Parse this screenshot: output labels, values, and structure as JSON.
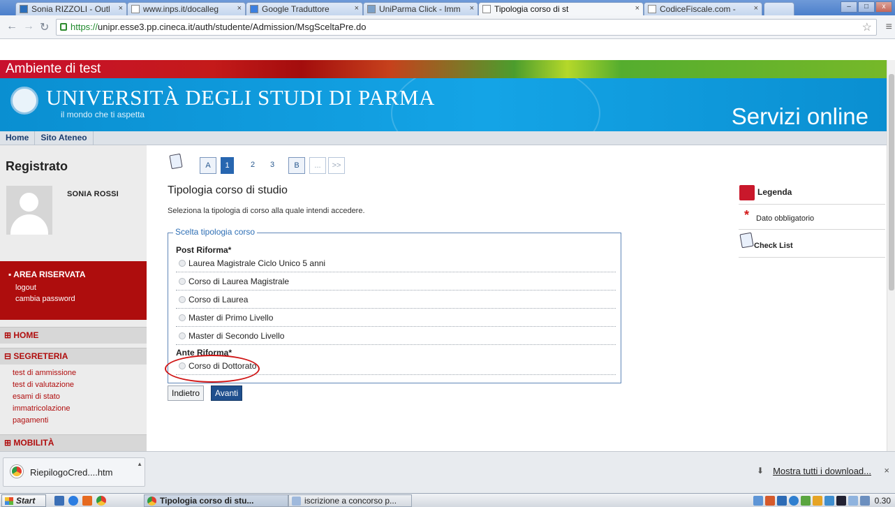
{
  "browser": {
    "tabs": [
      {
        "label": "Sonia RIZZOLI - Outl"
      },
      {
        "label": "www.inps.it/docalleg"
      },
      {
        "label": "Google Traduttore"
      },
      {
        "label": "UniParma Click - Imm"
      },
      {
        "label": "Tipologia corso di st",
        "active": true
      },
      {
        "label": "CodiceFiscale.com -"
      }
    ],
    "url_scheme": "https://",
    "url_rest": "unipr.esse3.pp.cineca.it/auth/studente/Admission/MsgSceltaPre.do"
  },
  "page": {
    "environment_label": "Ambiente di test",
    "university_name": "UNIVERSITÀ DEGLI STUDI DI PARMA",
    "tagline": "il mondo che ti aspetta",
    "services_label": "Servizi online",
    "topnav": [
      "Home",
      "Sito Ateneo"
    ]
  },
  "sidebar": {
    "title": "Registrato",
    "user_name": "SONIA ROSSI",
    "area_riservata": {
      "heading": "AREA RISERVATA",
      "links": [
        "logout",
        "cambia password"
      ]
    },
    "sections": [
      "HOME",
      "SEGRETERIA",
      "MOBILITÀ"
    ],
    "segreteria_links": [
      "test di ammissione",
      "test di valutazione",
      "esami di stato",
      "immatricolazione",
      "pagamenti"
    ]
  },
  "wizard": {
    "steps": [
      "A",
      "1",
      "2",
      "3",
      "B",
      "...",
      ">>"
    ]
  },
  "main": {
    "title": "Tipologia corso di studio",
    "intro": "Seleziona la tipologia di corso alla quale intendi accedere.",
    "legend": "Scelta tipologia corso",
    "groups": [
      {
        "label": "Post Riforma*",
        "options": [
          "Laurea Magistrale Ciclo Unico 5 anni",
          "Corso di Laurea Magistrale",
          "Corso di Laurea",
          "Master di Primo Livello",
          "Master di Secondo Livello"
        ]
      },
      {
        "label": "Ante Riforma*",
        "options": [
          "Corso di Dottorato"
        ]
      }
    ],
    "back_label": "Indietro",
    "next_label": "Avanti"
  },
  "legend_panel": {
    "title": "Legenda",
    "required_label": "Dato obbligatorio",
    "checklist_label": "Check List"
  },
  "downloads": {
    "file_name": "RiepilogoCred....htm",
    "show_all": "Mostra tutti i download..."
  },
  "taskbar": {
    "start": "Start",
    "tasks": [
      "Tipologia corso di stu...",
      "iscrizione a concorso p..."
    ],
    "clock": "0.30"
  },
  "colors": {
    "accent_blue": "#0a8fd1",
    "accent_red": "#ae0d0d",
    "button_primary": "#1f4f8d"
  }
}
